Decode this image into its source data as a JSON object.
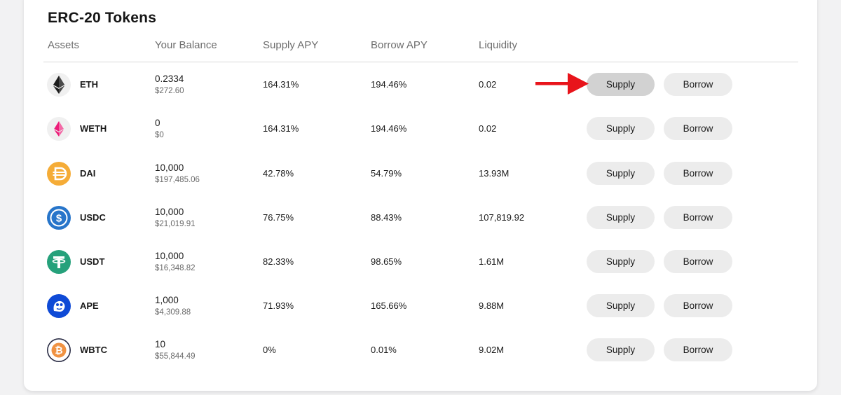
{
  "section": {
    "title": "ERC-20 Tokens"
  },
  "columns": {
    "assets": "Assets",
    "balance": "Your Balance",
    "supply_apy": "Supply APY",
    "borrow_apy": "Borrow APY",
    "liquidity": "Liquidity"
  },
  "rows": [
    {
      "symbol": "ETH",
      "icon": "eth-icon",
      "balance": "0.2334",
      "balance_usd": "$272.60",
      "supply_apy": "164.31%",
      "borrow_apy": "194.46%",
      "liquidity": "0.02",
      "supply_label": "Supply",
      "borrow_label": "Borrow"
    },
    {
      "symbol": "WETH",
      "icon": "weth-icon",
      "balance": "0",
      "balance_usd": "$0",
      "supply_apy": "164.31%",
      "borrow_apy": "194.46%",
      "liquidity": "0.02",
      "supply_label": "Supply",
      "borrow_label": "Borrow"
    },
    {
      "symbol": "DAI",
      "icon": "dai-icon",
      "balance": "10,000",
      "balance_usd": "$197,485.06",
      "supply_apy": "42.78%",
      "borrow_apy": "54.79%",
      "liquidity": "13.93M",
      "supply_label": "Supply",
      "borrow_label": "Borrow"
    },
    {
      "symbol": "USDC",
      "icon": "usdc-icon",
      "balance": "10,000",
      "balance_usd": "$21,019.91",
      "supply_apy": "76.75%",
      "borrow_apy": "88.43%",
      "liquidity": "107,819.92",
      "supply_label": "Supply",
      "borrow_label": "Borrow"
    },
    {
      "symbol": "USDT",
      "icon": "usdt-icon",
      "balance": "10,000",
      "balance_usd": "$16,348.82",
      "supply_apy": "82.33%",
      "borrow_apy": "98.65%",
      "liquidity": "1.61M",
      "supply_label": "Supply",
      "borrow_label": "Borrow"
    },
    {
      "symbol": "APE",
      "icon": "ape-icon",
      "balance": "1,000",
      "balance_usd": "$4,309.88",
      "supply_apy": "71.93%",
      "borrow_apy": "165.66%",
      "liquidity": "9.88M",
      "supply_label": "Supply",
      "borrow_label": "Borrow"
    },
    {
      "symbol": "WBTC",
      "icon": "wbtc-icon",
      "balance": "10",
      "balance_usd": "$55,844.49",
      "supply_apy": "0%",
      "borrow_apy": "0.01%",
      "liquidity": "9.02M",
      "supply_label": "Supply",
      "borrow_label": "Borrow"
    }
  ],
  "colors": {
    "arrow": "#e8141b",
    "eth": "#1d1d1d",
    "weth": "#ec1c79",
    "dai": "#f5ac37",
    "usdc": "#2775ca",
    "usdt": "#26a17b",
    "ape": "#0f4ad6",
    "wbtc": "#f09242"
  }
}
